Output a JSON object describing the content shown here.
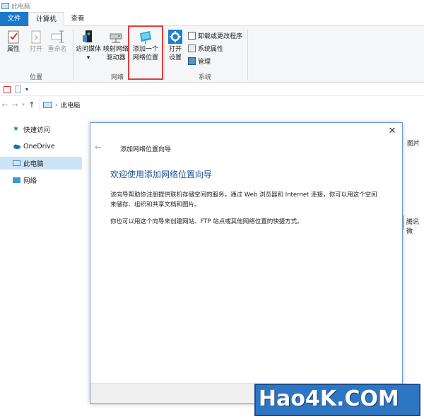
{
  "window": {
    "title": "此电脑"
  },
  "tabs": [
    {
      "label": "文件"
    },
    {
      "label": "计算机"
    },
    {
      "label": "查看"
    }
  ],
  "ribbon": {
    "groups": {
      "location": "位置",
      "network": "网络",
      "system": "系统"
    },
    "buttons": {
      "properties": "属性",
      "open": "打开",
      "rename": "重命名",
      "access_media_1": "访问媒体",
      "map_drive_1": "映射网络",
      "map_drive_2": "驱动器",
      "add_network_1": "添加一个",
      "add_network_2": "网络位置",
      "open_settings_1": "打开",
      "open_settings_2": "设置"
    },
    "small": {
      "uninstall": "卸载或更改程序",
      "sys_props": "系统属性",
      "manage": "管理"
    }
  },
  "address": {
    "path": "此电脑"
  },
  "nav": {
    "quick_access": "快速访问",
    "onedrive": "OneDrive",
    "this_pc": "此电脑",
    "network": "网络"
  },
  "background": {
    "pictures": "图片",
    "tencent": "腾讯微"
  },
  "dialog": {
    "title": "添加网络位置向导",
    "heading": "欢迎使用添加网络位置向导",
    "para1": "该向导帮助你注册提供联机存储空间的服务。通过 Web 浏览器和 Internet 连接，你可以用这个空间来储存、组织和共享文档和图片。",
    "para2": "你也可以用这个向导来创建网站、FTP 站点或其他网络位置的快捷方式。"
  },
  "watermark": {
    "text": "Hao4K.COM"
  },
  "colors": {
    "accent": "#1979ca",
    "highlight_box": "#e23b3b",
    "dialog_heading": "#1e4f9b",
    "nav_selected": "#cce4f7"
  }
}
